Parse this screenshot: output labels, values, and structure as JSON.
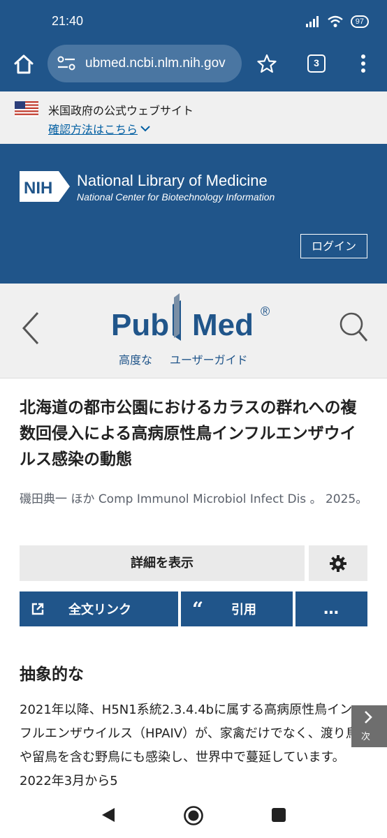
{
  "status_bar": {
    "time": "21:40",
    "battery": "97"
  },
  "browser": {
    "url": "ubmed.ncbi.nlm.nih.gov",
    "tab_count": "3"
  },
  "gov_banner": {
    "text": "米国政府の公式ウェブサイト",
    "link": "確認方法はこちら"
  },
  "nlm_header": {
    "logo_text": "NIH",
    "title": "National Library of Medicine",
    "subtitle": "National Center for Biotechnology Information",
    "login": "ログイン"
  },
  "pubmed_header": {
    "logo_pub": "Pub",
    "logo_med": "Med",
    "registered": "®",
    "advanced": "高度な",
    "user_guide": "ユーザーガイド"
  },
  "article": {
    "title": "北海道の都市公園におけるカラスの群れへの複数回侵入による高病原性鳥インフルエンザウイルス感染の動態",
    "authors": "磯田典一 ほか",
    "journal": "Comp Immunol Microbiol Infect Dis 。 2025。",
    "details_label": "詳細を表示",
    "full_text_label": "全文リンク",
    "cite_label": "引用",
    "more_label": "…",
    "abstract_heading": "抽象的な",
    "abstract_text": "2021年以降、H5N1系統2.3.4.4bに属する高病原性鳥インフルエンザウイルス（HPAIV）が、家禽だけでなく、渡り鳥や留鳥を含む野鳥にも感染し、世界中で蔓延しています。2022年3月から5",
    "next_label": "次"
  },
  "colors": {
    "header_blue": "#20558a",
    "pubmed_blue": "#20558a",
    "banner_gray": "#f0f0f0",
    "link_blue": "#005ea2"
  },
  "icons": [
    "home-icon",
    "tune-icon",
    "star-icon",
    "tabs-icon",
    "more-vert-icon",
    "us-flag-icon",
    "chevron-down-icon",
    "back-chevron-icon",
    "search-icon",
    "gear-icon",
    "external-link-icon",
    "quote-icon",
    "chevron-right-icon",
    "nav-back-icon",
    "nav-home-icon",
    "nav-recent-icon"
  ]
}
